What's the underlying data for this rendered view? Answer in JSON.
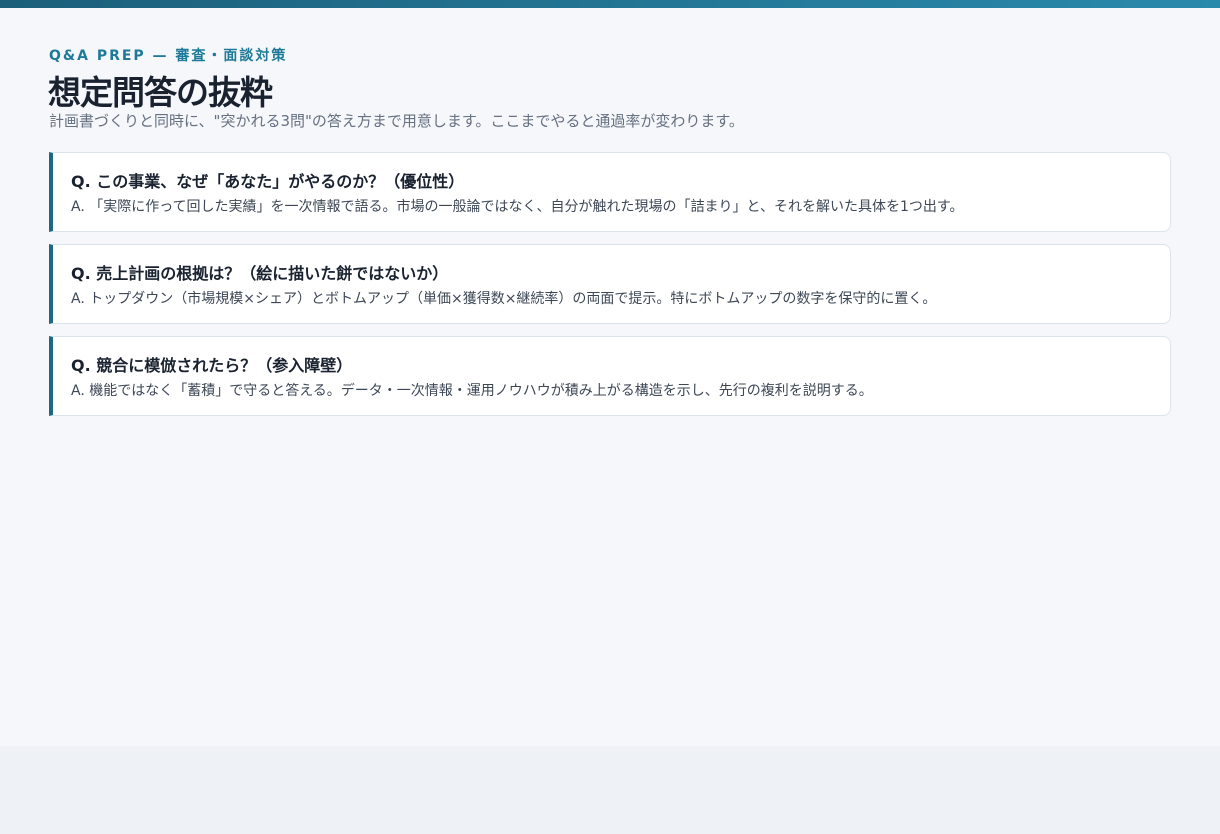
{
  "header": {
    "eyebrow": "Q&A PREP — 審査・面談対策",
    "title": "想定問答の抜粋",
    "subtitle": "計画書づくりと同時に、\"突かれる3問\"の答え方まで用意します。ここまでやると通過率が変わります。"
  },
  "qa": [
    {
      "question": "Q. この事業、なぜ「あなた」がやるのか？（優位性）",
      "answer": "A. 「実際に作って回した実績」を一次情報で語る。市場の一般論ではなく、自分が触れた現場の「詰まり」と、それを解いた具体を1つ出す。"
    },
    {
      "question": "Q. 売上計画の根拠は？（絵に描いた餅ではないか）",
      "answer": "A. トップダウン（市場規模×シェア）とボトムアップ（単価×獲得数×継続率）の両面で提示。特にボトムアップの数字を保守的に置く。"
    },
    {
      "question": "Q. 競合に模倣されたら？（参入障壁）",
      "answer": "A. 機能ではなく「蓄積」で守ると答える。データ・一次情報・運用ノウハウが積み上がる構造を示し、先行の複利を説明する。"
    }
  ],
  "colors": {
    "accent": "#1e6785",
    "eyebrow": "#1f7a99",
    "title": "#1a2230",
    "background": "#f5f7fa"
  }
}
